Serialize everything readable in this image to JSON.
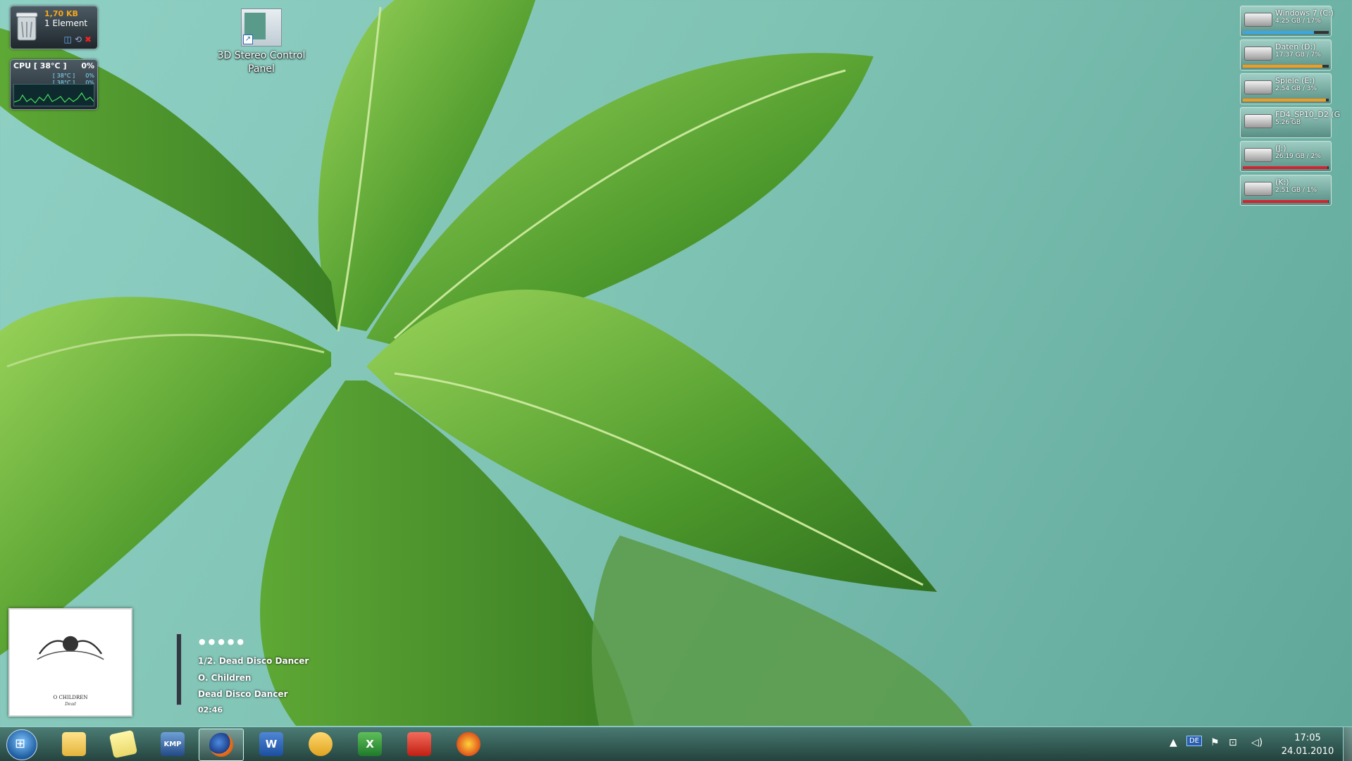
{
  "colors": {
    "accent_orange": "#f6a61b",
    "drive_blue": "#3aa7e8",
    "drive_orange": "#f29b1f",
    "drive_red": "#d42330"
  },
  "recycle_bin": {
    "size": "1,70 KB",
    "count": "1 Element"
  },
  "cpu_meter": {
    "label": "CPU [ 38°C ]",
    "total": "0%",
    "cores": [
      {
        "temp": "[ 38°C ]",
        "load": "0%"
      },
      {
        "temp": "[ 38°C ]",
        "load": "0%"
      }
    ]
  },
  "desktop_icons": [
    {
      "label_line1": "3D Stereo Control",
      "label_line2": "Panel"
    }
  ],
  "drives": [
    {
      "name": "Windows 7 (C:)",
      "info": "4.25 GB / 17%",
      "used_pct": 83,
      "color": "#3aa7e8"
    },
    {
      "name": "Daten (D:)",
      "info": "17.37 GB / 7%",
      "used_pct": 93,
      "color": "#f29b1f"
    },
    {
      "name": "Spiele (E:)",
      "info": "2.54 GB / 3%",
      "used_pct": 97,
      "color": "#f29b1f"
    },
    {
      "name": "FD4_SP10_D2 (G",
      "info": "5.26 GB",
      "used_pct": 0,
      "color": "#888888"
    },
    {
      "name": "(J:)",
      "info": "26.19 GB / 2%",
      "used_pct": 98,
      "color": "#d42330"
    },
    {
      "name": "(K:)",
      "info": "2.51 GB / 1%",
      "used_pct": 99,
      "color": "#d42330"
    }
  ],
  "media_player": {
    "album_title": "O CHILDREN",
    "album_subtitle": "Dead",
    "rating_dots": "●●●●●",
    "track": "1/2. Dead Disco Dancer",
    "artist": "O. Children",
    "album": "Dead Disco Dancer",
    "time": "02:46"
  },
  "taskbar": {
    "apps": [
      {
        "name": "windows-explorer",
        "icon": "folder-icon"
      },
      {
        "name": "sticky-notes",
        "icon": "notes-icon"
      },
      {
        "name": "kmplayer",
        "icon": "kmp-icon",
        "label": "KMP"
      },
      {
        "name": "firefox",
        "icon": "firefox-icon",
        "active": true
      },
      {
        "name": "word",
        "icon": "word-icon",
        "label": "W"
      },
      {
        "name": "outlook",
        "icon": "outlook-icon"
      },
      {
        "name": "excel",
        "icon": "excel-icon",
        "label": "X"
      },
      {
        "name": "acrobat",
        "icon": "acrobat-icon"
      },
      {
        "name": "gadget-app",
        "icon": "flower-icon"
      }
    ],
    "tray": {
      "lang": "DE"
    },
    "clock": {
      "time": "17:05",
      "date": "24.01.2010"
    }
  }
}
